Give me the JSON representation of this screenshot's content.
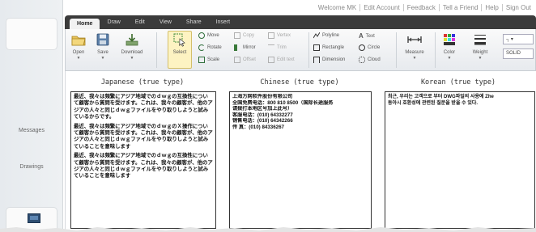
{
  "top_links": [
    "Welcome MK",
    "Edit Account",
    "Feedback",
    "Tell a Friend",
    "Help",
    "Sign Out"
  ],
  "sidebar": {
    "items": [
      {
        "label": "Messages"
      },
      {
        "label": "Drawings"
      }
    ]
  },
  "menu": {
    "tabs": [
      "Home",
      "Draw",
      "Edit",
      "View",
      "Share",
      "Insert"
    ]
  },
  "ribbon": {
    "big_buttons": {
      "open": "Open",
      "save": "Save",
      "download": "Download",
      "select": "Select",
      "measure": "Measure",
      "color": "Color",
      "weight": "Weight"
    },
    "small_tools": {
      "move": "Move",
      "rotate": "Rotate",
      "scale": "Scale",
      "copy": "Copy",
      "mirror": "Mirror",
      "offset": "Offset",
      "vertex": "Vertex",
      "trim": "Trim",
      "edit_text": "Edit text",
      "polyline": "Polyline",
      "rectangle": "Rectangle",
      "dimension": "Dimension",
      "text": "Text",
      "circle": "Circle",
      "cloud": "Cloud"
    },
    "linetype_value": "SOLID",
    "linetype_top": ""
  },
  "columns": [
    {
      "heading": "Japanese (true type)",
      "paragraphs": [
        "最近、我々は頻繁にアジア地域でのｄｗｇの互換性について顧客から質問を受けます。これは、我々の顧客が、他のアジアの人々と同じｄｗｇファイルをやり取りしようと試みているからです。",
        "最近、我々は頻繁にアジア地域でのｄｗｇのＸ操作について顧客から質問を受けます。これは、我々の顧客が、他のアジアの人々と同じｄｗｇファイルをやり取りしようと試みていることを意味します",
        "最近、我々は頻繁にアジア地域でのｄｗｇの互換性について顧客から質問を受けます。これは、我々の顧客が、他のアジアの人々と同じｄｗｇファイルをやり取りしようと試みていることを意味します"
      ]
    },
    {
      "heading": "Chinese (true type)",
      "lines": [
        "上海万网软件股份有限公司",
        "全国免费电话：800 810 8500（国际长途服务",
        "请拨打本地区号加上此号）",
        "客服电话：(010) 64332277",
        "销售电话：(010) 64342266",
        "传 真：(010) 84336267"
      ]
    },
    {
      "heading": "Korean (true type)",
      "lines": [
        "최근, 우리는 고객으로 부터 DWG파일의 사용에 Zhe",
        "동아시 호환성에 관련된 질문을 받을 수 있다."
      ]
    }
  ]
}
